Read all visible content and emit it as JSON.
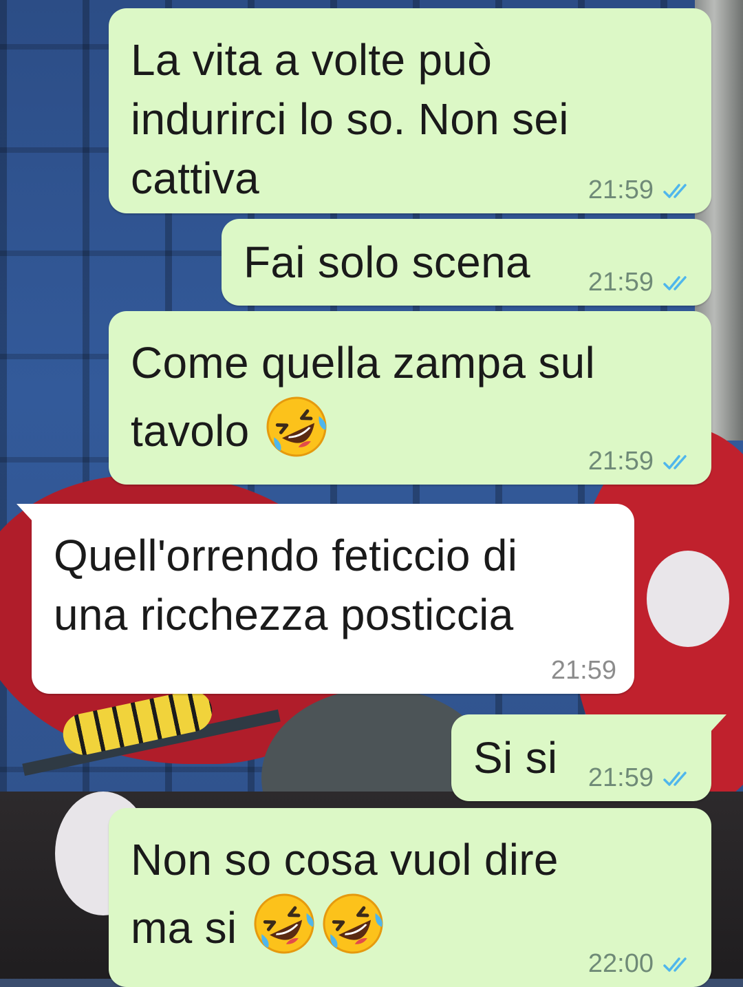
{
  "messages": [
    {
      "direction": "outgoing",
      "text": "La vita a volte può\nindurirci lo so. Non sei\ncattiva",
      "time": "21:59",
      "status": "read"
    },
    {
      "direction": "outgoing",
      "text": "Fai solo scena",
      "time": "21:59",
      "status": "read"
    },
    {
      "direction": "outgoing",
      "text": "Come quella zampa sul\ntavolo",
      "emoji": [
        "rolling-on-floor-laughing-emoji"
      ],
      "time": "21:59",
      "status": "read"
    },
    {
      "direction": "incoming",
      "text": "Quell'orrendo feticcio di\nuna ricchezza posticcia",
      "time": "21:59"
    },
    {
      "direction": "outgoing",
      "text": "Si si",
      "time": "21:59",
      "status": "read"
    },
    {
      "direction": "outgoing",
      "text": "Non so cosa vuol dire\nma si",
      "emoji": [
        "rolling-on-floor-laughing-emoji",
        "rolling-on-floor-laughing-emoji"
      ],
      "time": "22:00",
      "status": "read"
    }
  ],
  "colors": {
    "outgoing_bubble": "#dcf8c6",
    "incoming_bubble": "#ffffff",
    "read_ticks": "#4fb6ec"
  },
  "icons": {
    "read_receipt": "double-check-icon"
  }
}
